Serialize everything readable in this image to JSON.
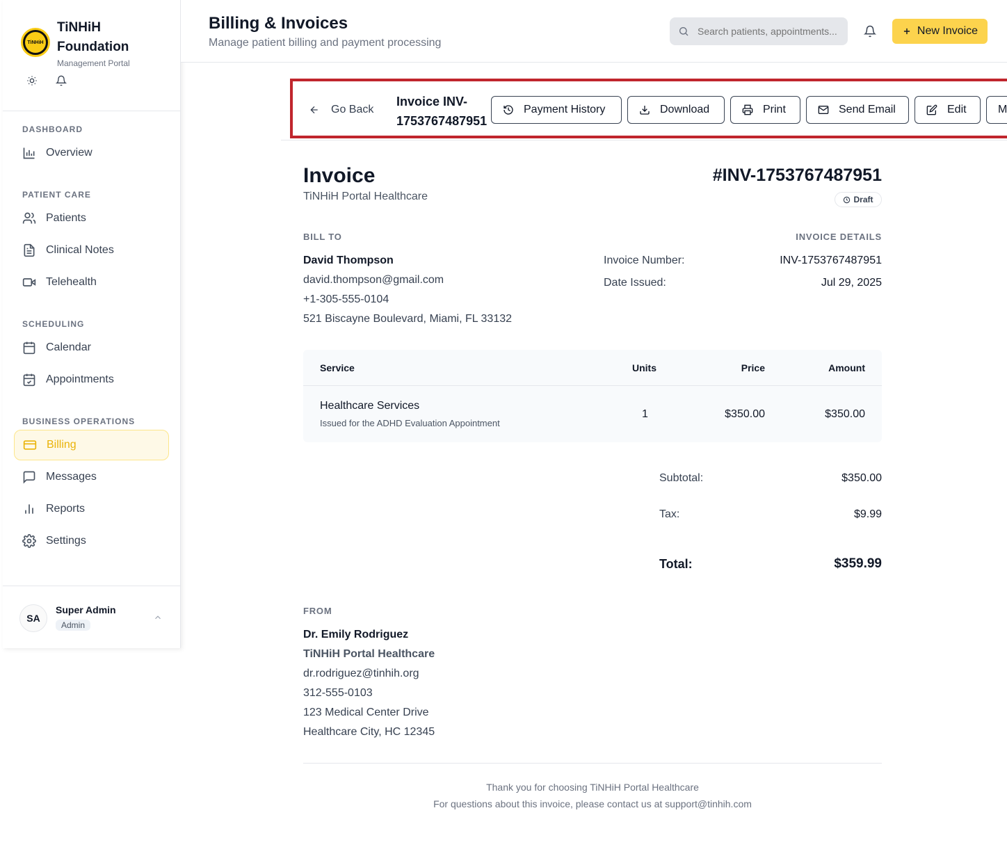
{
  "sidebar": {
    "brand_title": "TiNHiH Foundation",
    "brand_subtitle": "Management Portal",
    "logo_text": "TiNHiH",
    "sections": [
      {
        "label": "DASHBOARD",
        "items": [
          {
            "label": "Overview",
            "icon": "bar-chart-icon"
          }
        ]
      },
      {
        "label": "PATIENT CARE",
        "items": [
          {
            "label": "Patients",
            "icon": "users-icon"
          },
          {
            "label": "Clinical Notes",
            "icon": "file-text-icon"
          },
          {
            "label": "Telehealth",
            "icon": "video-icon"
          }
        ]
      },
      {
        "label": "SCHEDULING",
        "items": [
          {
            "label": "Calendar",
            "icon": "calendar-icon"
          },
          {
            "label": "Appointments",
            "icon": "calendar-check-icon"
          }
        ]
      },
      {
        "label": "BUSINESS OPERATIONS",
        "items": [
          {
            "label": "Billing",
            "icon": "credit-card-icon",
            "active": true
          },
          {
            "label": "Messages",
            "icon": "message-square-icon"
          },
          {
            "label": "Reports",
            "icon": "bar-chart-2-icon"
          },
          {
            "label": "Settings",
            "icon": "settings-icon"
          }
        ]
      }
    ],
    "user": {
      "initials": "SA",
      "name": "Super Admin",
      "role": "Admin"
    }
  },
  "header": {
    "title": "Billing & Invoices",
    "subtitle": "Manage patient billing and payment processing",
    "search_placeholder": "Search patients, appointments...",
    "new_invoice_label": "New Invoice"
  },
  "toolbar": {
    "go_back": "Go Back",
    "invoice_title": "Invoice INV-1753767487951",
    "buttons": [
      "Payment History",
      "Download",
      "Print",
      "Send Email",
      "Edit",
      "M"
    ]
  },
  "invoice": {
    "heading": "Invoice",
    "company": "TiNHiH Portal Healthcare",
    "number_display": "#INV-1753767487951",
    "status": "Draft",
    "bill_to_label": "BILL TO",
    "bill_to": {
      "name": "David Thompson",
      "email": "david.thompson@gmail.com",
      "phone": "+1-305-555-0104",
      "address": "521 Biscayne Boulevard, Miami, FL 33132"
    },
    "details_label": "INVOICE DETAILS",
    "details": {
      "number_label": "Invoice Number:",
      "number": "INV-1753767487951",
      "date_label": "Date Issued:",
      "date": "Jul 29, 2025"
    },
    "table": {
      "headers": [
        "Service",
        "Units",
        "Price",
        "Amount"
      ],
      "rows": [
        {
          "service": "Healthcare Services",
          "description": "Issued for the ADHD Evaluation Appointment",
          "units": "1",
          "price": "$350.00",
          "amount": "$350.00"
        }
      ]
    },
    "totals": {
      "subtotal_label": "Subtotal:",
      "subtotal": "$350.00",
      "tax_label": "Tax:",
      "tax": "$9.99",
      "total_label": "Total:",
      "total": "$359.99"
    },
    "from_label": "FROM",
    "from": {
      "name": "Dr. Emily Rodriguez",
      "org": "TiNHiH Portal Healthcare",
      "email": "dr.rodriguez@tinhih.org",
      "phone": "312-555-0103",
      "address1": "123 Medical Center Drive",
      "address2": "Healthcare City, HC 12345"
    },
    "footer1": "Thank you for choosing TiNHiH Portal Healthcare",
    "footer2": "For questions about this invoice, please contact us at support@tinhih.com"
  }
}
